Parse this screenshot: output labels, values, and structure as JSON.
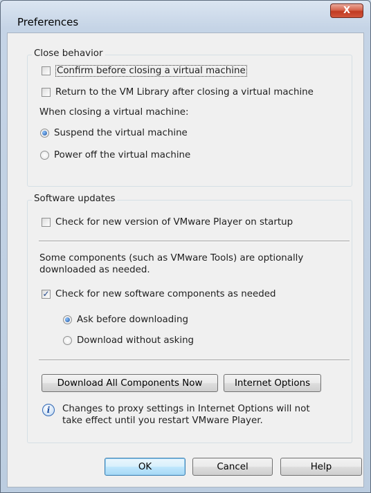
{
  "window": {
    "title": "Preferences",
    "close_glyph": "X"
  },
  "close_behavior": {
    "legend": "Close behavior",
    "confirm_label": "Confirm before closing a virtual machine",
    "confirm_checked": false,
    "return_label": "Return to the VM Library after closing a virtual machine",
    "return_checked": false,
    "when_closing_text": "When closing a virtual machine:",
    "suspend_label": "Suspend the virtual machine",
    "suspend_selected": true,
    "poweroff_label": "Power off the virtual machine",
    "poweroff_selected": false
  },
  "software_updates": {
    "legend": "Software updates",
    "check_version_label": "Check for new version of VMware Player on startup",
    "check_version_checked": false,
    "components_text_1": "Some components (such as VMware Tools) are optionally",
    "components_text_2": "downloaded as needed.",
    "check_components_label": "Check for new software components as needed",
    "check_components_checked": true,
    "ask_label": "Ask before downloading",
    "ask_selected": true,
    "download_label": "Download without asking",
    "download_selected": false,
    "download_all_button": "Download All Components Now",
    "internet_options_button": "Internet Options",
    "info_icon": "info-icon",
    "info_text_1": "Changes to proxy settings in Internet Options will not",
    "info_text_2": "take effect until you restart VMware Player."
  },
  "buttons": {
    "ok": "OK",
    "cancel": "Cancel",
    "help": "Help"
  },
  "colors": {
    "default_button": "#bee6fd",
    "close_button": "#c13b22",
    "dialog_bg": "#f0f0f0"
  }
}
